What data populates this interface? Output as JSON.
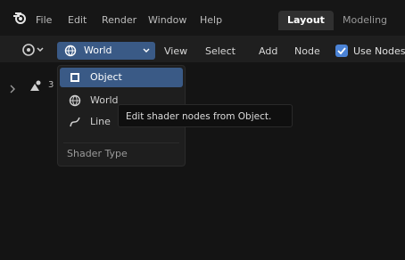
{
  "topbar": {
    "menus": [
      "File",
      "Edit",
      "Render",
      "Window",
      "Help"
    ],
    "workspace_tabs": [
      {
        "label": "Layout",
        "active": true
      },
      {
        "label": "Modeling",
        "active": false
      }
    ]
  },
  "header": {
    "shader_type_selected": "World",
    "menus": [
      "View",
      "Select",
      "Add",
      "Node"
    ],
    "use_nodes_label": "Use Nodes",
    "use_nodes_checked": true
  },
  "canvas": {
    "node_count": "3"
  },
  "dropdown": {
    "items": [
      {
        "label": "Object",
        "icon": "object-icon",
        "selected": true
      },
      {
        "label": "World",
        "icon": "world-icon",
        "selected": false
      },
      {
        "label": "Line",
        "icon": "line-style-icon",
        "selected": false
      }
    ],
    "title": "Shader Type"
  },
  "tooltip": {
    "text": "Edit shader nodes from Object."
  },
  "colors": {
    "accent": "#3a5a86",
    "checkbox": "#4b83d6",
    "background": "#141414"
  }
}
